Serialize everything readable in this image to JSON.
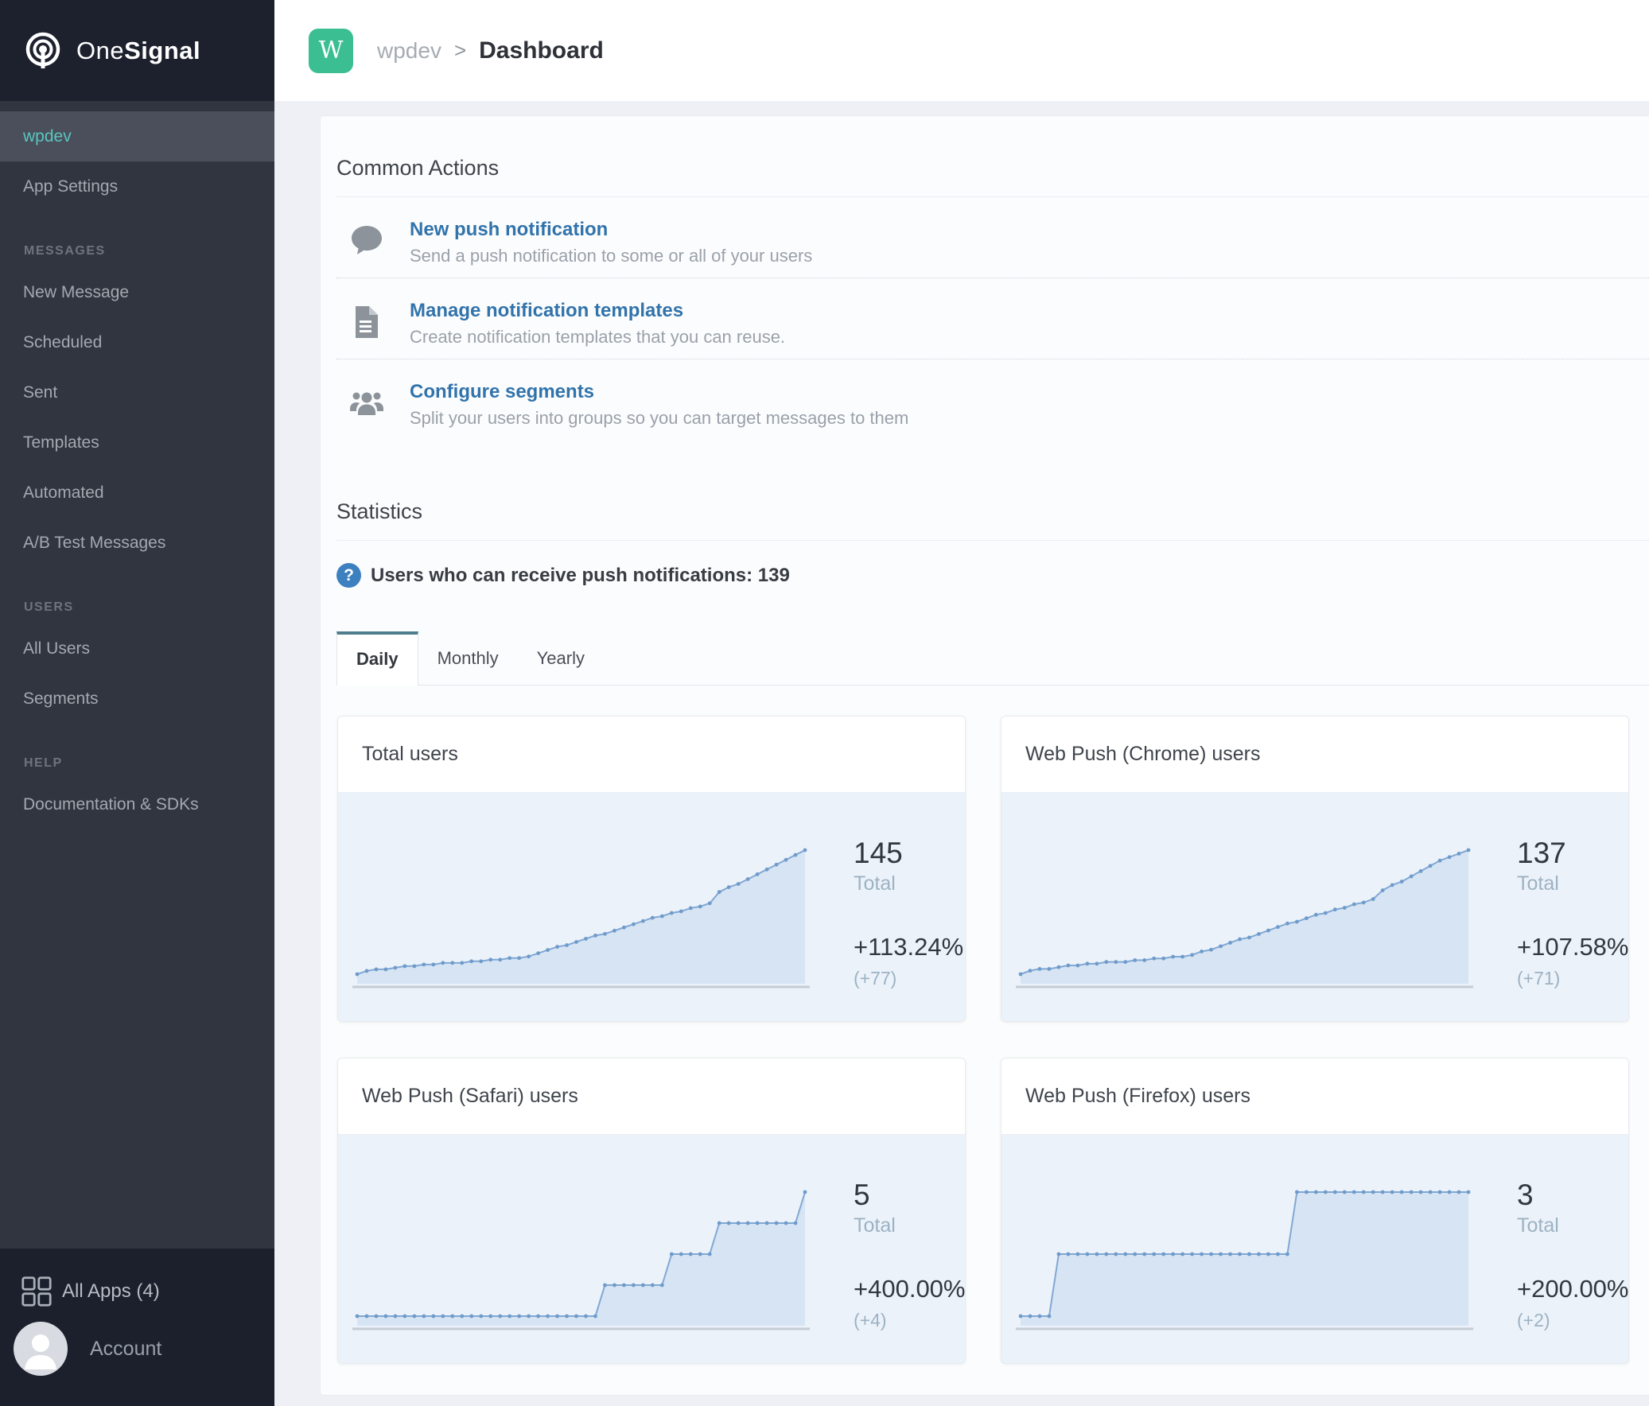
{
  "colors": {
    "sidebar_bg": "#31353f",
    "sidebar_header_bg": "#1c212d",
    "active_item_teal": "#5ac6bf",
    "app_tile_green": "#3bbf92",
    "link_blue": "#3173ab",
    "tab_accent_teal": "#4e7e8e",
    "help_icon_blue": "#3c80bf",
    "chart_bg": "#ebf2fa",
    "chart_fill": "#d6e4f4",
    "chart_line": "#82a8d3"
  },
  "sidebar": {
    "brand": {
      "prefix": "One",
      "suffix": "Signal"
    },
    "app_item": "wpdev",
    "app_settings": "App Settings",
    "sections": [
      {
        "label": "MESSAGES",
        "items": [
          "New Message",
          "Scheduled",
          "Sent",
          "Templates",
          "Automated",
          "A/B Test Messages"
        ]
      },
      {
        "label": "USERS",
        "items": [
          "All Users",
          "Segments"
        ]
      },
      {
        "label": "HELP",
        "items": [
          "Documentation & SDKs"
        ]
      }
    ],
    "footer": {
      "all_apps": "All Apps (4)",
      "account": "Account"
    }
  },
  "header": {
    "app_initial": "W",
    "app_name": "wpdev",
    "separator": ">",
    "page_title": "Dashboard"
  },
  "common_actions": {
    "title": "Common Actions",
    "actions": [
      {
        "icon": "chat-bubble-icon",
        "title": "New push notification",
        "subtitle": "Send a push notification to some or all of your users"
      },
      {
        "icon": "document-icon",
        "title": "Manage notification templates",
        "subtitle": "Create notification templates that you can reuse."
      },
      {
        "icon": "people-icon",
        "title": "Configure segments",
        "subtitle": "Split your users into groups so you can target messages to them"
      }
    ]
  },
  "statistics": {
    "title": "Statistics",
    "subscribers_label": "Users who can receive push notifications: 139",
    "tabs": [
      "Daily",
      "Monthly",
      "Yearly"
    ],
    "active_tab": "Daily"
  },
  "chart_data": [
    {
      "type": "area",
      "title": "Total users",
      "total": "145",
      "total_label": "Total",
      "pct_change": "+113.24%",
      "delta": "(+77)",
      "values": [
        68,
        70,
        71,
        71,
        72,
        73,
        73,
        74,
        74,
        75,
        75,
        75,
        76,
        76,
        77,
        77,
        78,
        78,
        79,
        81,
        83,
        85,
        86,
        88,
        90,
        92,
        93,
        95,
        97,
        99,
        101,
        103,
        104,
        106,
        107,
        109,
        110,
        112,
        119,
        122,
        124,
        127,
        130,
        133,
        136,
        139,
        142,
        145
      ]
    },
    {
      "type": "area",
      "title": "Web Push (Chrome) users",
      "total": "137",
      "total_label": "Total",
      "pct_change": "+107.58%",
      "delta": "(+71)",
      "values": [
        66,
        68,
        69,
        69,
        70,
        71,
        71,
        72,
        72,
        73,
        73,
        73,
        74,
        74,
        75,
        75,
        76,
        76,
        77,
        79,
        80,
        82,
        84,
        86,
        87,
        89,
        91,
        93,
        95,
        96,
        98,
        100,
        101,
        103,
        104,
        106,
        107,
        109,
        114,
        117,
        119,
        122,
        125,
        128,
        131,
        133,
        135,
        137
      ]
    },
    {
      "type": "area",
      "title": "Web Push (Safari) users",
      "total": "5",
      "total_label": "Total",
      "pct_change": "+400.00%",
      "delta": "(+4)",
      "values": [
        1,
        1,
        1,
        1,
        1,
        1,
        1,
        1,
        1,
        1,
        1,
        1,
        1,
        1,
        1,
        1,
        1,
        1,
        1,
        1,
        1,
        1,
        1,
        1,
        1,
        1,
        2,
        2,
        2,
        2,
        2,
        2,
        2,
        3,
        3,
        3,
        3,
        3,
        4,
        4,
        4,
        4,
        4,
        4,
        4,
        4,
        4,
        5
      ]
    },
    {
      "type": "area",
      "title": "Web Push (Firefox) users",
      "total": "3",
      "total_label": "Total",
      "pct_change": "+200.00%",
      "delta": "(+2)",
      "values": [
        1,
        1,
        1,
        1,
        2,
        2,
        2,
        2,
        2,
        2,
        2,
        2,
        2,
        2,
        2,
        2,
        2,
        2,
        2,
        2,
        2,
        2,
        2,
        2,
        2,
        2,
        2,
        2,
        2,
        3,
        3,
        3,
        3,
        3,
        3,
        3,
        3,
        3,
        3,
        3,
        3,
        3,
        3,
        3,
        3,
        3,
        3,
        3
      ]
    }
  ]
}
